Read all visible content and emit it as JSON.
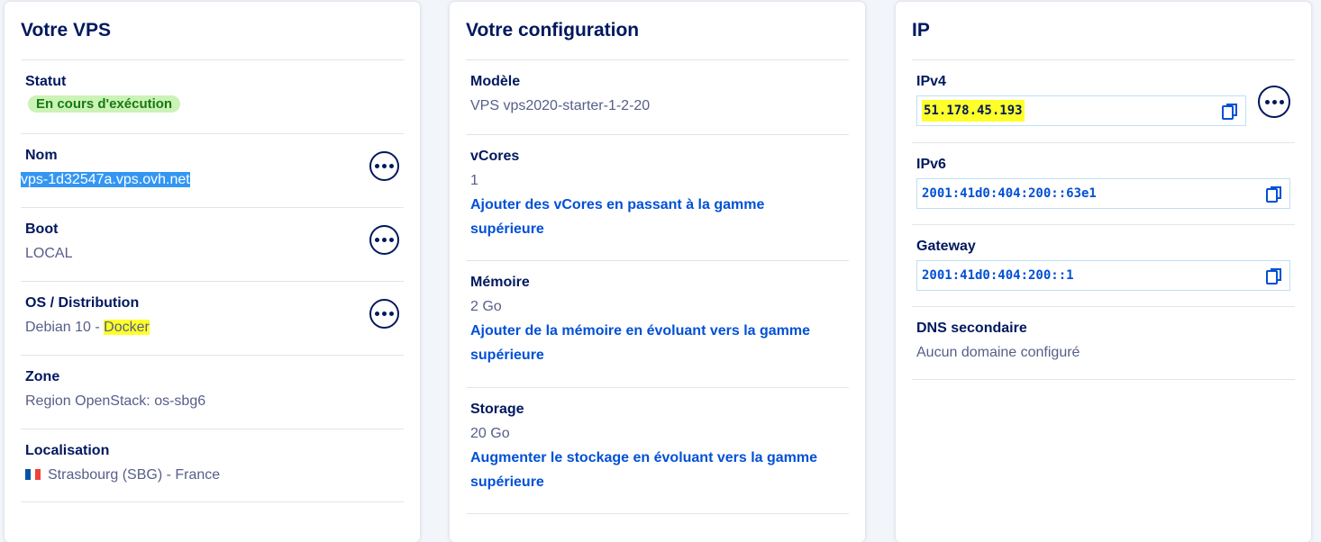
{
  "vps_card": {
    "title": "Votre VPS",
    "status": {
      "label": "Statut",
      "value": "En cours d'exécution"
    },
    "name": {
      "label": "Nom",
      "value": "vps-1d32547a.vps.ovh.net"
    },
    "boot": {
      "label": "Boot",
      "value": "LOCAL"
    },
    "os": {
      "label": "OS / Distribution",
      "value_prefix": "Debian 10 - ",
      "value_highlight": "Docker"
    },
    "zone": {
      "label": "Zone",
      "value": "Region OpenStack: os-sbg6"
    },
    "location": {
      "label": "Localisation",
      "value": "Strasbourg (SBG) - France",
      "flag_icon": "france-flag-icon"
    }
  },
  "config_card": {
    "title": "Votre configuration",
    "model": {
      "label": "Modèle",
      "value": "VPS vps2020-starter-1-2-20"
    },
    "vcores": {
      "label": "vCores",
      "value": "1",
      "link": "Ajouter des vCores en passant à la gamme supérieure"
    },
    "memory": {
      "label": "Mémoire",
      "value": "2 Go",
      "link": "Ajouter de la mémoire en évoluant vers la gamme supérieure"
    },
    "storage": {
      "label": "Storage",
      "value": "20 Go",
      "link": "Augmenter le stockage en évoluant vers la gamme supérieure"
    }
  },
  "ip_card": {
    "title": "IP",
    "ipv4": {
      "label": "IPv4",
      "value": "51.178.45.193"
    },
    "ipv6": {
      "label": "IPv6",
      "value": "2001:41d0:404:200::63e1"
    },
    "gateway": {
      "label": "Gateway",
      "value": "2001:41d0:404:200::1"
    },
    "dns": {
      "label": "DNS secondaire",
      "value": "Aucun domaine configuré"
    }
  },
  "colors": {
    "title": "#00185e",
    "link": "#0050d7",
    "badge_bg": "#cbf2b7",
    "badge_text": "#157a10",
    "highlight_yellow": "#ffff2a",
    "highlight_blue": "#3396f3"
  }
}
